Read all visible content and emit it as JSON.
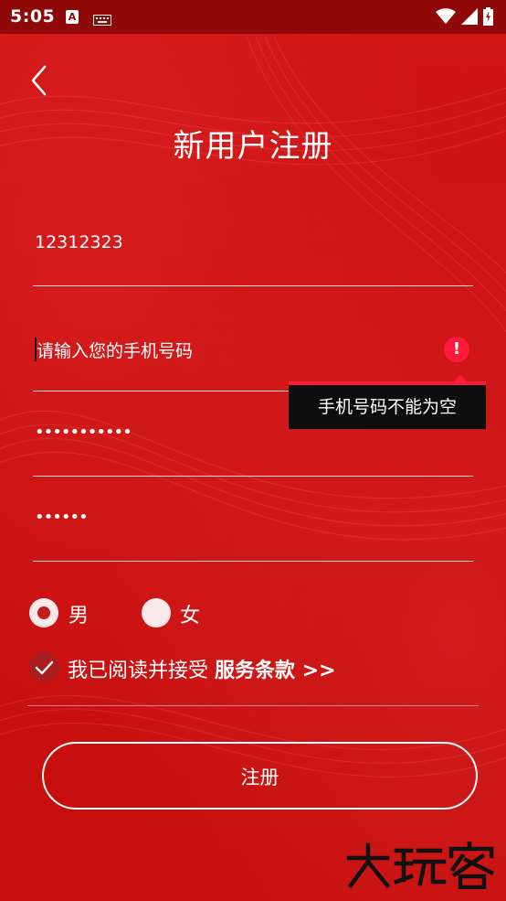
{
  "status_bar": {
    "time": "5:05",
    "app_badge": "A"
  },
  "header": {
    "title": "新用户注册"
  },
  "form": {
    "username_value": "12312323",
    "phone_placeholder": "请输入您的手机号码",
    "password_mask": "•••••••••••",
    "confirm_password_mask": "••••••",
    "phone_error": "手机号码不能为空",
    "gender": {
      "options": [
        "男",
        "女"
      ],
      "selected": "男"
    },
    "agreement": {
      "text": "我已阅读并接受 ",
      "link": "服务条款 >>",
      "checked": true
    },
    "submit_label": "注册"
  },
  "watermark": "大玩客",
  "colors": {
    "background": "#cc1111",
    "status_bar": "#8f0909",
    "error_accent": "#ff1a3c",
    "tooltip_bg": "#0d0d0d"
  },
  "icons": [
    "back-arrow-icon",
    "wifi-icon",
    "signal-icon",
    "battery-icon",
    "keyboard-icon",
    "error-icon",
    "check-icon"
  ]
}
